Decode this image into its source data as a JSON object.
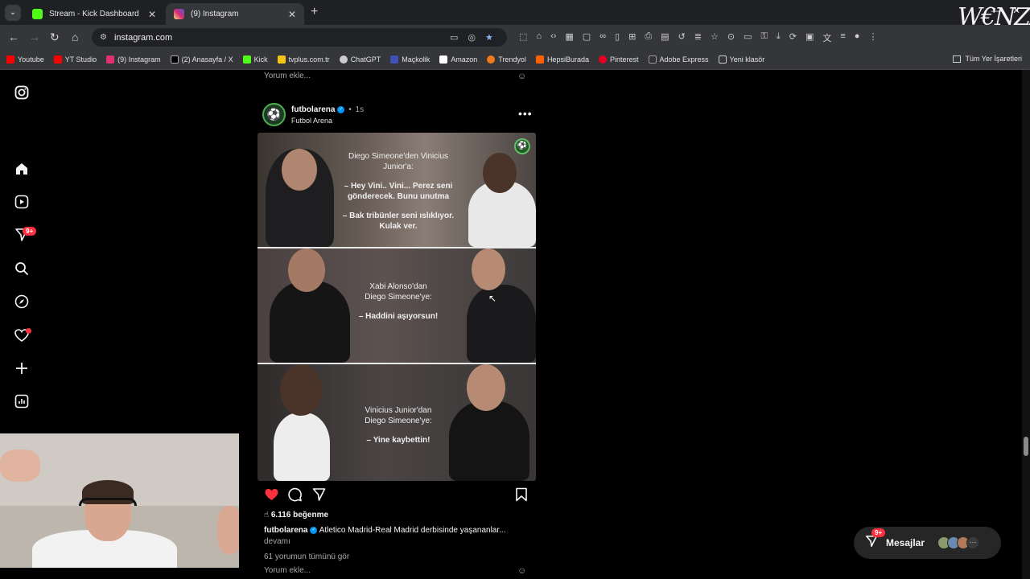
{
  "browser": {
    "tabs": [
      {
        "title": "Stream - Kick Dashboard",
        "favicon_color": "#53fc18"
      },
      {
        "title": "(9) Instagram",
        "favicon_color": "#e1306c"
      }
    ],
    "url": "instagram.com",
    "bookmarks": [
      {
        "label": "Youtube",
        "color": "#ff0000"
      },
      {
        "label": "YT Studio",
        "color": "#ff0000"
      },
      {
        "label": "(9) Instagram",
        "color": "#e1306c"
      },
      {
        "label": "(2) Anasayfa / X",
        "color": "#000000"
      },
      {
        "label": "Kick",
        "color": "#53fc18"
      },
      {
        "label": "tvplus.com.tr",
        "color": "#f5c518"
      },
      {
        "label": "ChatGPT",
        "color": "#cccccc"
      },
      {
        "label": "Maçkolik",
        "color": "#3f51b5"
      },
      {
        "label": "Amazon",
        "color": "#ffffff"
      },
      {
        "label": "Trendyol",
        "color": "#f27a1a"
      },
      {
        "label": "HepsiBurada",
        "color": "#ff6000"
      },
      {
        "label": "Pinterest",
        "color": "#e60023"
      },
      {
        "label": "Adobe Express",
        "color": "#333333"
      },
      {
        "label": "Yeni klasör",
        "color": "#cccccc"
      }
    ],
    "all_bookmarks": "Tüm Yer İşaretleri"
  },
  "feed": {
    "prev_post_add_comment": "Yorum ekle...",
    "post": {
      "username": "futbolarena",
      "time": "1s",
      "subtitle": "Futbol Arena",
      "panels": [
        {
          "line1": "Diego Simeone'den Vinicius",
          "line2": "Junior'a:",
          "quote1a": "– Hey Vini.. Vini... Perez seni",
          "quote1b": "gönderecek. Bunu unutma",
          "quote2a": "– Bak tribünler seni ıslıklıyor.",
          "quote2b": "Kulak ver."
        },
        {
          "line1": "Xabi Alonso'dan",
          "line2": "Diego Simeone'ye:",
          "quote": "– Haddini aşıyorsun!"
        },
        {
          "line1": "Vinicius Junior'dan",
          "line2": "Diego Simeone'ye:",
          "quote": "– Yine kaybettin!"
        }
      ],
      "likes": "6.116 beğenme",
      "caption_user": "futbolarena",
      "caption_text": "Atletico Madrid-Real Madrid derbisinde yaşananlar...",
      "more": "devamı",
      "view_comments": "61 yorumun tümünü gör",
      "add_comment": "Yorum ekle..."
    }
  },
  "sidebar": {
    "notifications_badge": "9+"
  },
  "messages": {
    "label": "Mesajlar",
    "badge": "9+"
  },
  "overlay": {
    "watermark": "WENZZLE"
  }
}
